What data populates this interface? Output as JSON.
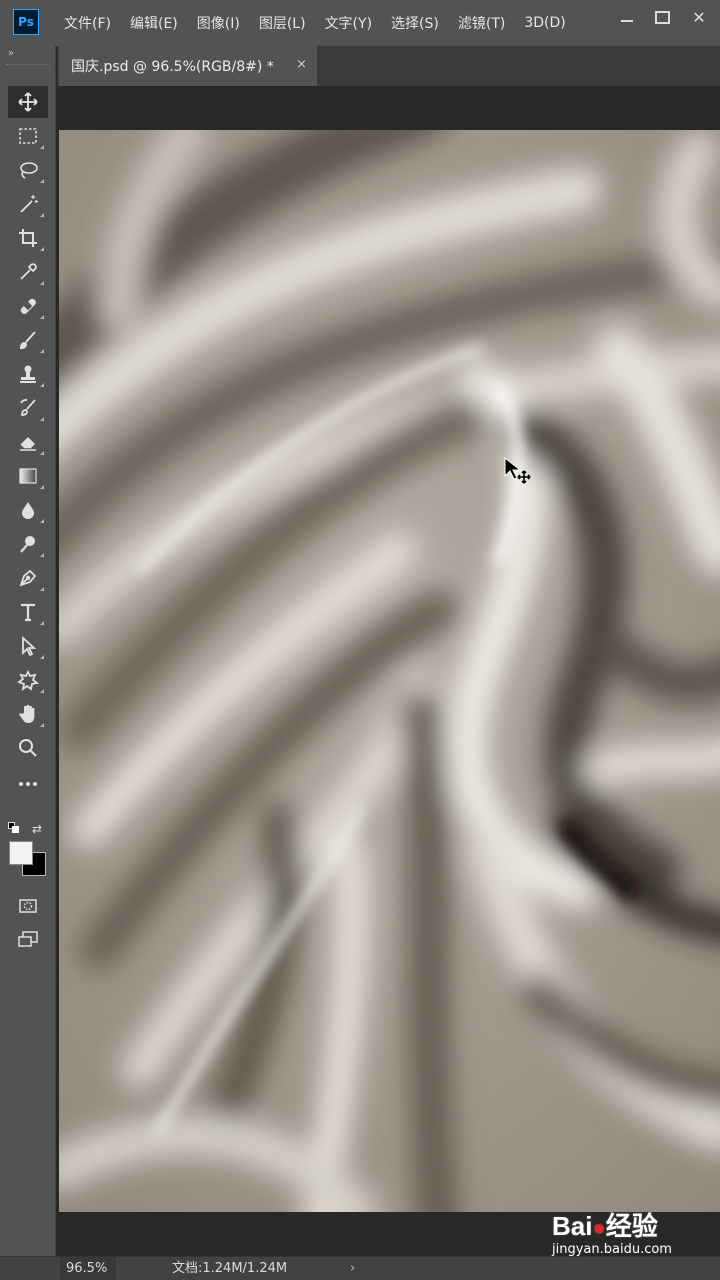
{
  "app": {
    "logo_text": "Ps",
    "menu": [
      "文件(F)",
      "编辑(E)",
      "图像(I)",
      "图层(L)",
      "文字(Y)",
      "选择(S)",
      "滤镜(T)",
      "3D(D)"
    ],
    "window_close": "✕"
  },
  "document": {
    "tab_title": "国庆.psd @ 96.5%(RGB/8#) *",
    "tab_close": "×"
  },
  "toolbox": {
    "grip": "»",
    "tools": [
      {
        "name": "move-tool",
        "icon": "move-icon",
        "active": true
      },
      {
        "name": "marquee-tool",
        "icon": "rect-marquee-icon"
      },
      {
        "name": "lasso-tool",
        "icon": "lasso-icon"
      },
      {
        "name": "magic-wand-tool",
        "icon": "magic-wand-icon"
      },
      {
        "name": "crop-tool",
        "icon": "crop-icon"
      },
      {
        "name": "eyedropper-tool",
        "icon": "eyedropper-icon"
      },
      {
        "name": "healing-tool",
        "icon": "bandage-icon"
      },
      {
        "name": "brush-tool",
        "icon": "brush-icon"
      },
      {
        "name": "stamp-tool",
        "icon": "stamp-icon"
      },
      {
        "name": "history-brush-tool",
        "icon": "history-brush-icon"
      },
      {
        "name": "eraser-tool",
        "icon": "eraser-icon"
      },
      {
        "name": "gradient-tool",
        "icon": "gradient-icon"
      },
      {
        "name": "blur-tool",
        "icon": "drop-icon"
      },
      {
        "name": "dodge-tool",
        "icon": "dodge-icon"
      },
      {
        "name": "pen-tool",
        "icon": "pen-icon"
      },
      {
        "name": "type-tool",
        "icon": "type-icon"
      },
      {
        "name": "path-select-tool",
        "icon": "arrow-icon"
      },
      {
        "name": "shape-tool",
        "icon": "custom-shape-icon"
      },
      {
        "name": "hand-tool",
        "icon": "hand-icon"
      },
      {
        "name": "zoom-tool",
        "icon": "magnifier-icon"
      },
      {
        "name": "more-tools",
        "icon": "ellipsis-icon"
      }
    ],
    "colors": {
      "foreground": "#f2f2f2",
      "background": "#000000"
    },
    "swap_icon": "⇄"
  },
  "status": {
    "zoom": "96.5%",
    "doc_size": "文档:1.24M/1.24M",
    "arrow": "›"
  },
  "watermark": {
    "logo_left": "Bai",
    "logo_right": "经验",
    "url": "jingyan.baidu.com"
  }
}
